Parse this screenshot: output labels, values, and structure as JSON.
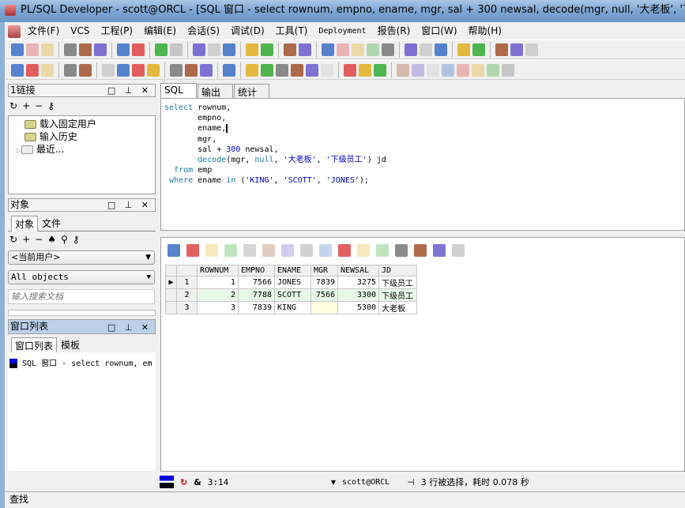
{
  "title": "PL/SQL Developer - scott@ORCL - [SQL 窗口 - select rownum, empno, ename, mgr, sal + 300 newsal, decode(mgr, null, '大老板', '下级员工') jd from emp",
  "menu": [
    "文件(F)",
    "VCS",
    "工程(P)",
    "编辑(E)",
    "会话(S)",
    "调试(D)",
    "工具(T)",
    "Deployment",
    "报告(R)",
    "窗口(W)",
    "帮助(H)"
  ],
  "toolbar1": [
    "new-icon",
    "open-icon",
    "reopen-icon",
    "sep",
    "save-icon",
    "save-as-icon",
    "save-all-icon",
    "sep",
    "print-icon",
    "print-setup-icon",
    "sep",
    "undo-icon",
    "redo-icon",
    "sep",
    "cut-icon",
    "copy-icon",
    "paste-icon",
    "sep",
    "find-icon",
    "find-next-icon",
    "sep",
    "indent-icon",
    "unindent-icon",
    "sep",
    "execute-icon",
    "step-icon",
    "step-over-icon",
    "break-icon",
    "clear-icon",
    "sep",
    "explain-icon",
    "explain2-icon",
    "explain3-icon",
    "sep",
    "windows-icon",
    "tile-icon",
    "sep",
    "oracle-icon",
    "pdf-icon",
    "info-icon"
  ],
  "toolbar2": [
    "key-icon",
    "gear-icon",
    "pen-icon",
    "sep",
    "db-icon",
    "db2-icon",
    "sep",
    "commit-icon",
    "sql-icon",
    "session-icon",
    "rollback-icon",
    "sep",
    "keys-icon",
    "report-icon",
    "clock-icon",
    "sep",
    "wrench-icon",
    "sep",
    "bookmark-icon",
    "eraser-icon",
    "book-red-icon",
    "book-yellow-icon",
    "book-edit-icon",
    "book-pen-icon",
    "sep",
    "arrow-right-blue-icon",
    "arrow-right-red-icon",
    "toolbox-icon",
    "sep",
    "obj1-icon",
    "obj2-icon",
    "obj3-icon",
    "obj4-icon",
    "obj5-icon",
    "obj6-icon",
    "obj7-icon",
    "obj8-icon"
  ],
  "left": {
    "connections": {
      "title": "1链接",
      "items": [
        "载入固定用户",
        "输入历史",
        "最近..."
      ]
    },
    "objects": {
      "title": "对象",
      "tabs": [
        "对象",
        "文件"
      ],
      "user_combo": "<当前用户>",
      "type_combo": "All objects",
      "search_placeholder": "输入搜索文档"
    },
    "windows": {
      "title": "窗口列表",
      "tabs": [
        "窗口列表",
        "模板"
      ],
      "items": [
        "SQL 窗口 - select rownum, em"
      ]
    }
  },
  "editor_tabs": [
    "SQL",
    "输出",
    "统计表"
  ],
  "grid": {
    "columns": [
      "ROWNUM",
      "EMPNO",
      "ENAME",
      "MGR",
      "NEWSAL",
      "JD"
    ],
    "rows": [
      [
        "1",
        "1",
        "7566",
        "JONES",
        "7839",
        "3275",
        "下级员工"
      ],
      [
        "2",
        "2",
        "7788",
        "SCOTT",
        "7566",
        "3300",
        "下级员工"
      ],
      [
        "3",
        "3",
        "7839",
        "KING",
        "",
        "5300",
        "大老板"
      ]
    ]
  },
  "status": {
    "position": "3:14",
    "connection": "scott@ORCL",
    "message": "3 行被选择，耗时 0.078 秒"
  },
  "findbar": "查找"
}
